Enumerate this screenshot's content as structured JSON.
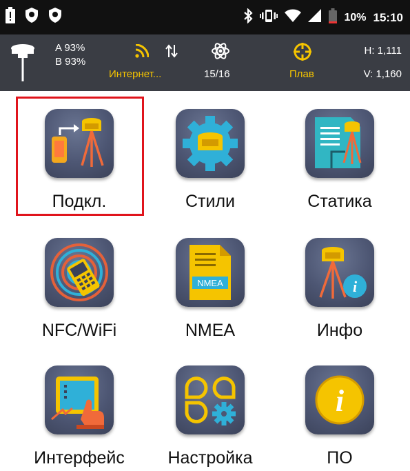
{
  "status_bar": {
    "battery_percent": "10%",
    "time": "15:10",
    "icons": [
      "battery-icon",
      "shield-icon",
      "shield-icon",
      "bluetooth-icon",
      "vibrate-icon",
      "wifi-icon",
      "signal-icon",
      "battery-low-icon"
    ]
  },
  "top_bar": {
    "channel_a": "A 93%",
    "channel_b": "B 93%",
    "internet_label": "Интернет...",
    "satellites": "15/16",
    "mode_label": "Плав",
    "h_value": "H: 1,111",
    "v_value": "V: 1,160"
  },
  "apps": [
    {
      "label": "Подкл.",
      "icon": "connect-icon"
    },
    {
      "label": "Стили",
      "icon": "styles-icon"
    },
    {
      "label": "Статика",
      "icon": "static-icon"
    },
    {
      "label": "NFC/WiFi",
      "icon": "nfc-wifi-icon"
    },
    {
      "label": "NMEA",
      "icon": "nmea-icon"
    },
    {
      "label": "Инфо",
      "icon": "info-icon"
    },
    {
      "label": "Интерфейс",
      "icon": "interface-icon"
    },
    {
      "label": "Настройка",
      "icon": "settings-icon"
    },
    {
      "label": "ПО",
      "icon": "firmware-icon"
    }
  ],
  "nmea_icon_text": "NMEA",
  "colors": {
    "status_bar": "#111111",
    "top_bar": "#3a3d44",
    "accent_yellow": "#f5c400",
    "highlight_red": "#e0141c",
    "icon_tile": "#4d5673"
  }
}
